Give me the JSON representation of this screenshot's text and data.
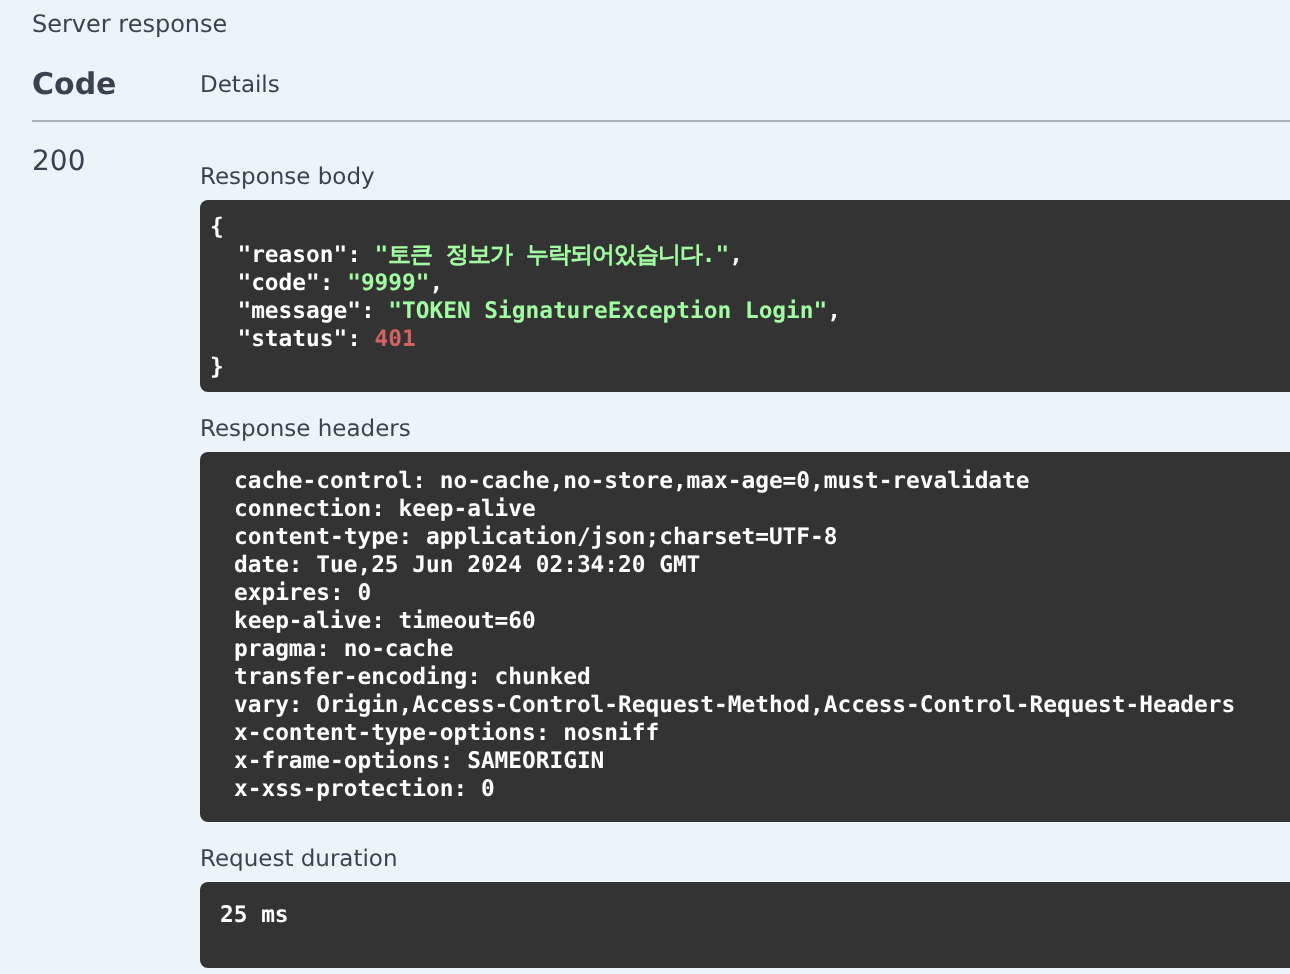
{
  "section_title": "Server response",
  "columns": [
    "Code",
    "Details"
  ],
  "response": {
    "code": "200",
    "body": {
      "label": "Response body",
      "open": "{",
      "close": "}",
      "entries": [
        {
          "key": "\"reason\": ",
          "value": "\"토큰 정보가 누락되어있습니다.\"",
          "kind": "string",
          "comma": ","
        },
        {
          "key": "\"code\": ",
          "value": "\"9999\"",
          "kind": "string",
          "comma": ","
        },
        {
          "key": "\"message\": ",
          "value": "\"TOKEN SignatureException Login\"",
          "kind": "string",
          "comma": ","
        },
        {
          "key": "\"status\": ",
          "value": "401",
          "kind": "number"
        }
      ]
    },
    "headers": {
      "label": "Response headers",
      "lines": [
        "cache-control: no-cache,no-store,max-age=0,must-revalidate",
        "connection: keep-alive",
        "content-type: application/json;charset=UTF-8",
        "date: Tue,25 Jun 2024 02:34:20 GMT",
        "expires: 0",
        "keep-alive: timeout=60",
        "pragma: no-cache",
        "transfer-encoding: chunked",
        "vary: Origin,Access-Control-Request-Method,Access-Control-Request-Headers",
        "x-content-type-options: nosniff",
        "x-frame-options: SAMEORIGIN",
        "x-xss-protection: 0"
      ]
    },
    "duration": {
      "label": "Request duration",
      "value": "25 ms"
    }
  }
}
